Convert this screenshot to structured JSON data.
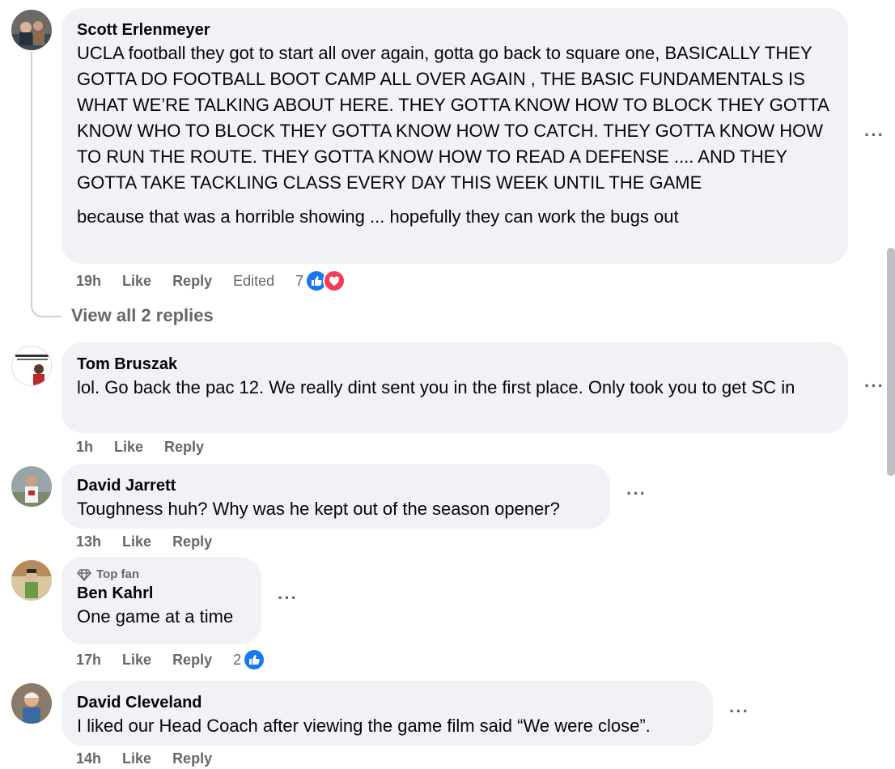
{
  "comments": [
    {
      "author": "Scott Erlenmeyer",
      "text": "UCLA football they got to start all over again, gotta go back to square one, BASICALLY THEY GOTTA DO FOOTBALL BOOT CAMP ALL OVER AGAIN , THE BASIC FUNDAMENTALS IS WHAT WE’RE TALKING ABOUT HERE. THEY GOTTA KNOW HOW TO BLOCK THEY GOTTA KNOW WHO TO BLOCK THEY GOTTA KNOW HOW TO CATCH. THEY GOTTA KNOW HOW TO RUN THE ROUTE. THEY GOTTA KNOW HOW TO READ A DEFENSE .... AND THEY GOTTA TAKE TACKLING CLASS EVERY DAY THIS WEEK UNTIL THE GAME",
      "text2": "because that was a horrible showing ... hopefully they can work the bugs out",
      "time": "19h",
      "like": "Like",
      "reply": "Reply",
      "edited": "Edited",
      "reactions": "7",
      "view_replies": "View all 2 replies"
    },
    {
      "author": "Tom Bruszak",
      "text": "lol. Go back the pac 12. We really dint sent you in the first place. Only took you to get SC in",
      "time": "1h",
      "like": "Like",
      "reply": "Reply"
    },
    {
      "author": "David Jarrett",
      "text": "Toughness huh? Why was he kept out of the season opener?",
      "time": "13h",
      "like": "Like",
      "reply": "Reply"
    },
    {
      "badge": "Top fan",
      "author": "Ben Kahrl",
      "text": "One game at a time",
      "time": "17h",
      "like": "Like",
      "reply": "Reply",
      "reactions": "2"
    },
    {
      "author": "David Cleveland",
      "text": "I liked our Head Coach after viewing the game film said “We were close”.",
      "time": "14h",
      "like": "Like",
      "reply": "Reply"
    }
  ],
  "more_label": "···",
  "icons": {
    "like": "thumbs-up-icon",
    "love": "heart-icon",
    "badge": "diamond-icon",
    "more": "more-options-icon"
  },
  "colors": {
    "bubble": "#f0f2f5",
    "meta": "#65676b",
    "like": "#1877f2",
    "love": "#f33e58"
  }
}
